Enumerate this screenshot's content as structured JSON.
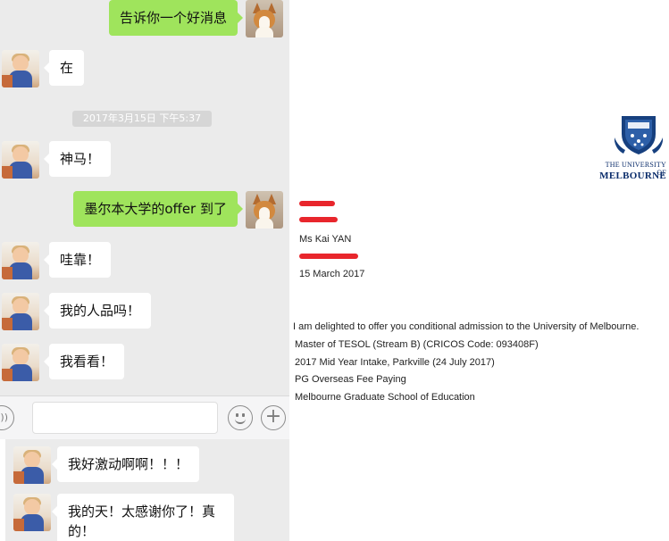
{
  "chat": {
    "messages": [
      {
        "side": "right",
        "text": "告诉你一个好消息",
        "avatar": "corgi-avatar"
      },
      {
        "side": "left",
        "text": "在",
        "avatar": "baby-avatar"
      },
      {
        "side": "left",
        "text": "神马！",
        "avatar": "baby-avatar"
      },
      {
        "side": "right",
        "text": "墨尔本大学的offer 到了",
        "avatar": "corgi-avatar"
      },
      {
        "side": "left",
        "text": "哇靠！",
        "avatar": "baby-avatar"
      },
      {
        "side": "left",
        "text": "我的人品吗！",
        "avatar": "baby-avatar"
      },
      {
        "side": "left",
        "text": "我看看！",
        "avatar": "baby-avatar"
      }
    ],
    "timestamp": "2017年3月15日 下午5:37",
    "colors": {
      "background": "#ebebeb",
      "sent_bubble": "#9fe45c",
      "received_bubble": "#ffffff"
    }
  },
  "input_bar": {
    "voice_icon": "voice-icon",
    "emoji_icon": "emoji-icon",
    "plus_icon": "plus-icon",
    "voice_glyph": "·))",
    "plus_glyph": "+"
  },
  "chat2": {
    "messages": [
      {
        "side": "left",
        "text": "我好激动啊啊！！！",
        "avatar": "baby-avatar"
      },
      {
        "side": "left",
        "text": "我的天！太感谢你了！真的！",
        "avatar": "baby-avatar"
      }
    ]
  },
  "letter": {
    "university": {
      "line1": "THE UNIVERSITY OF",
      "line2": "MELBOURNE",
      "color": "#0b2d6b"
    },
    "recipient": "Ms Kai YAN",
    "date": "15 March 2017",
    "intro": "I am delighted to offer you conditional admission to the University of Melbourne.",
    "course": "Master of TESOL (Stream B) (CRICOS Code: 093408F)",
    "intake": "2017 Mid Year Intake, Parkville (24 July 2017)",
    "fee_type": "PG Overseas Fee Paying",
    "school": "Melbourne Graduate School of Education",
    "redaction_color": "#e8262c"
  }
}
